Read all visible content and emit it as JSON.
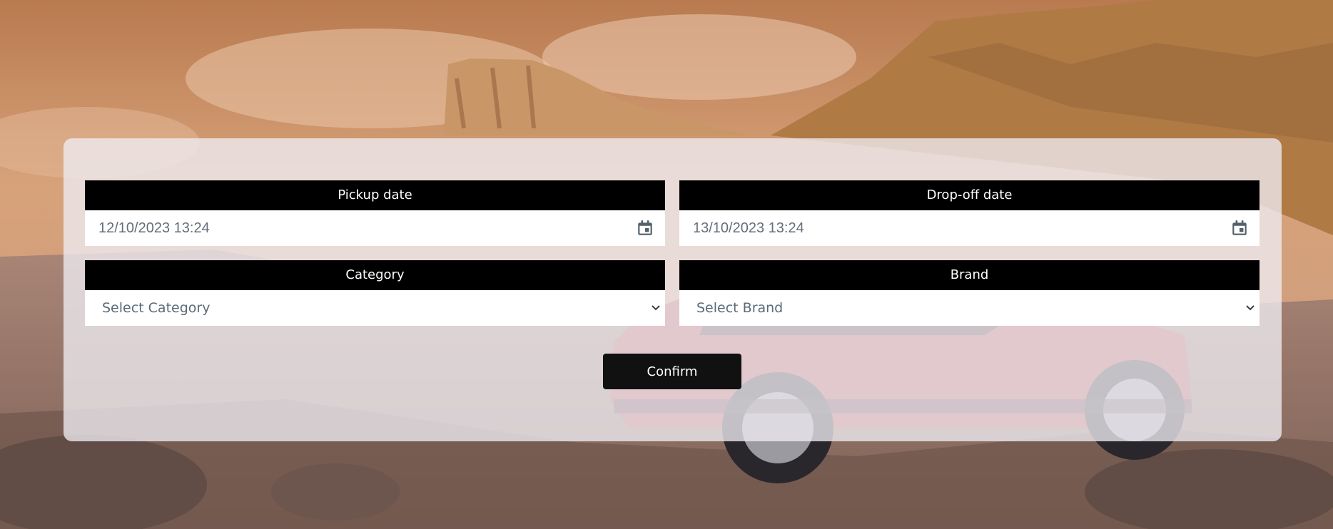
{
  "background": {
    "image": "mountain-desert-red-car-photo"
  },
  "form": {
    "pickup": {
      "label": "Pickup date",
      "value": "12/10/2023 13:24",
      "icon": "calendar-icon"
    },
    "dropoff": {
      "label": "Drop-off date",
      "value": "13/10/2023 13:24",
      "icon": "calendar-icon"
    },
    "category": {
      "label": "Category",
      "selected": "Select Category",
      "icon": "chevron-down-icon"
    },
    "brand": {
      "label": "Brand",
      "selected": "Select Brand",
      "icon": "chevron-down-icon"
    },
    "confirm_label": "Confirm"
  },
  "colors": {
    "label_bg": "#000000",
    "label_text": "#ffffff",
    "input_text": "#646e7a",
    "panel_bg": "#eeecf2",
    "button_bg": "#111111"
  }
}
